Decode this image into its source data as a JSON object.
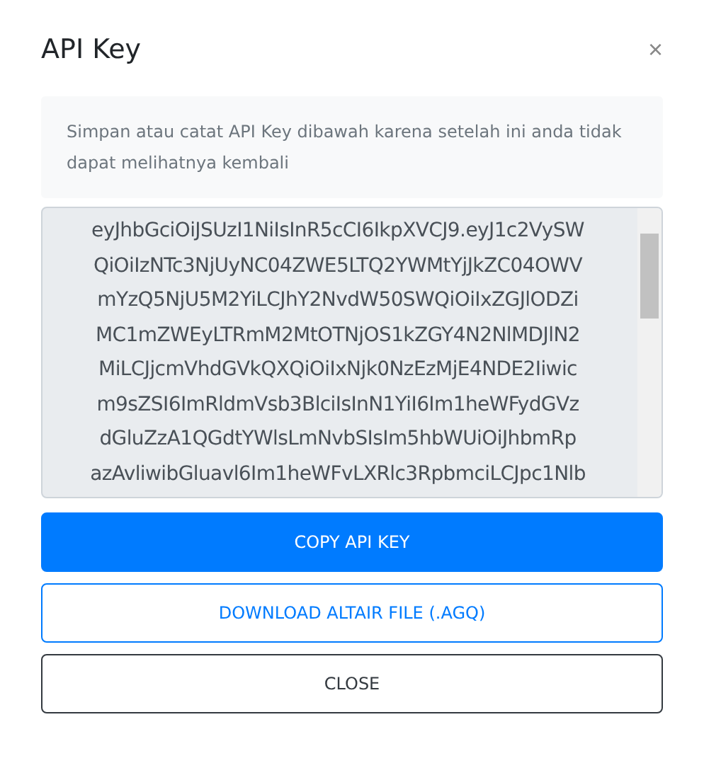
{
  "dialog": {
    "title": "API Key",
    "close": "×"
  },
  "notice": "Simpan atau catat API Key dibawah karena setelah ini anda tidak dapat melihatnya kembali",
  "api_key_field": {
    "lines": [
      "eyJhbGciOiJSUzI1NiIsInR5cCI6IkpXVCJ9.eyJ1c2VySW",
      "QiOiIzNTc3NjUyNC04ZWE5LTQ2YWMtYjJkZC04OWV",
      "mYzQ5NjU5M2YiLCJhY2NvdW50SWQiOiIxZGJlODZi",
      "MC1mZWEyLTRmM2MtOTNjOS1kZGY4N2NlMDJlN2",
      "MiLCJjcmVhdGVkQXQiOiIxNjk0NzEzMjE4NDE2Iiwic",
      "m9sZSI6ImRldmVsb3BlciIsInN1YiI6Im1heWFydGVz",
      "dGluZzA1QGdtYWlsLmNvbSIsIm5hbWUiOiJhbmRp",
      "azAvliwibGluavl6Im1heWFvLXRlc3RpbmciLCJpc1Nlb"
    ]
  },
  "buttons": [
    {
      "label": "COPY API KEY",
      "kind": "primary"
    },
    {
      "label": "DOWNLOAD ALTAIR FILE (.AGQ)",
      "kind": "outline-primary"
    },
    {
      "label": "CLOSE",
      "kind": "outline-dark"
    }
  ]
}
